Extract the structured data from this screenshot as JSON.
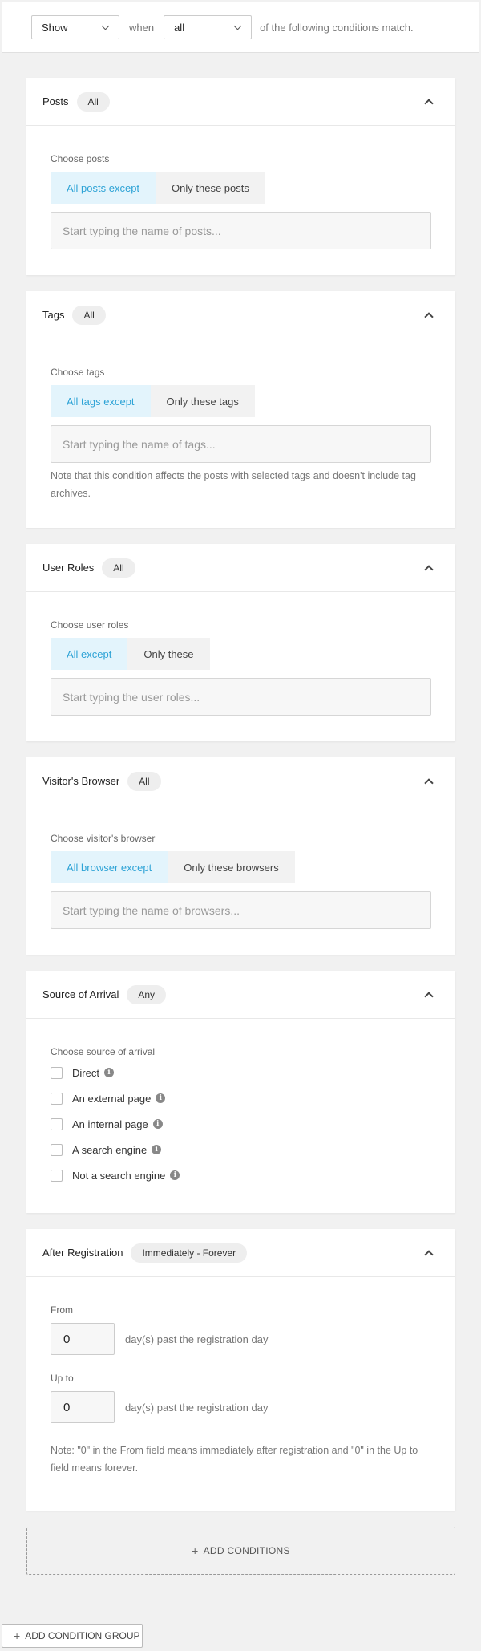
{
  "topbar": {
    "show_value": "Show",
    "when_text": "when",
    "match_value": "all",
    "suffix_text": "of the following conditions match."
  },
  "cards": {
    "posts": {
      "title": "Posts",
      "pill": "All",
      "label": "Choose posts",
      "option_on": "All posts except",
      "option_off": "Only these posts",
      "placeholder": "Start typing the name of posts..."
    },
    "tags": {
      "title": "Tags",
      "pill": "All",
      "label": "Choose tags",
      "option_on": "All tags except",
      "option_off": "Only these tags",
      "placeholder": "Start typing the name of tags...",
      "note": "Note that this condition affects the posts with selected tags and doesn't include tag archives."
    },
    "roles": {
      "title": "User Roles",
      "pill": "All",
      "label": "Choose user roles",
      "option_on": "All except",
      "option_off": "Only these",
      "placeholder": "Start typing the user roles..."
    },
    "browser": {
      "title": "Visitor's Browser",
      "pill": "All",
      "label": "Choose visitor's browser",
      "option_on": "All browser except",
      "option_off": "Only these browsers",
      "placeholder": "Start typing the name of browsers..."
    },
    "source": {
      "title": "Source of Arrival",
      "pill": "Any",
      "label": "Choose source of arrival",
      "options": [
        "Direct",
        "An external page",
        "An internal page",
        "A search engine",
        "Not a search engine"
      ]
    },
    "registration": {
      "title": "After Registration",
      "pill": "Immediately - Forever",
      "from_label": "From",
      "from_value": "0",
      "upto_label": "Up to",
      "upto_value": "0",
      "suffix": "day(s) past the registration day",
      "note": "Note: \"0\" in the From field means immediately after registration and \"0\" in the Up to field means forever."
    }
  },
  "add_conditions_label": "ADD CONDITIONS",
  "add_group_label": "ADD CONDITION GROUP",
  "icons": {
    "plus": "+",
    "info": "i"
  }
}
